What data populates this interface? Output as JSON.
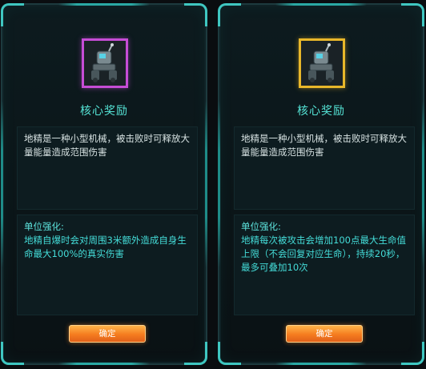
{
  "left_card": {
    "rarity_color": "#c64dd6",
    "title": "核心奖励",
    "description": "地精是一种小型机械，被击败时可释放大量能量造成范围伤害",
    "bonus_heading": "单位强化:",
    "bonus_text": "地精自爆时会对周围3米额外造成自身生命最大100%的真实伤害",
    "confirm_label": "确定"
  },
  "right_card": {
    "rarity_color": "#e8b72a",
    "title": "核心奖励",
    "description": "地精是一种小型机械，被击败时可释放大量能量造成范围伤害",
    "bonus_heading": "单位强化:",
    "bonus_text": "地精每次被攻击会增加100点最大生命值上限（不会回复对应生命），持续20秒，最多可叠加10次",
    "confirm_label": "确定"
  },
  "icons": {
    "unit_portrait": "goblin-mech-icon"
  }
}
